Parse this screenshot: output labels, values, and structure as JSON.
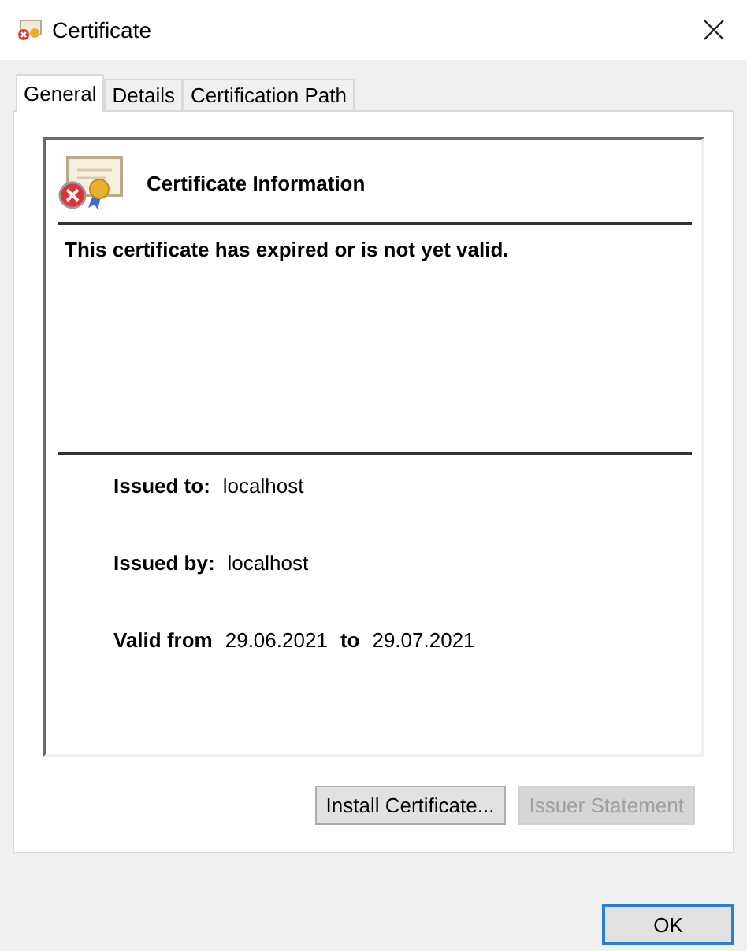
{
  "window": {
    "title": "Certificate"
  },
  "tabs": [
    {
      "label": "General",
      "selected": true
    },
    {
      "label": "Details",
      "selected": false
    },
    {
      "label": "Certification Path",
      "selected": false
    }
  ],
  "info": {
    "heading": "Certificate Information",
    "message": "This certificate has expired or is not yet valid.",
    "issued_to_label": "Issued to:",
    "issued_to": "localhost",
    "issued_by_label": "Issued by:",
    "issued_by": "localhost",
    "valid_from_label": "Valid from",
    "valid_from": "29.06.2021",
    "to_label": "to",
    "valid_to": "29.07.2021"
  },
  "buttons": [
    {
      "label": "Install Certificate...",
      "disabled": false
    },
    {
      "label": "Issuer Statement",
      "disabled": true
    }
  ],
  "ok_button": {
    "label": "OK"
  }
}
